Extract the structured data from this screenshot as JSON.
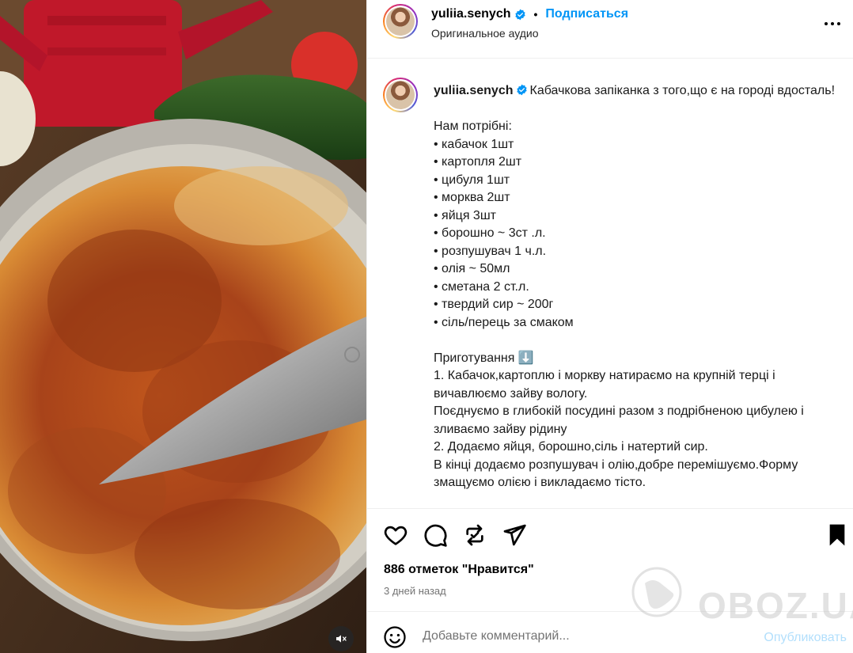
{
  "media": {
    "mute_icon": "speaker-muted-icon"
  },
  "header": {
    "username": "yuliia.senych",
    "separator": "•",
    "follow_label": "Подписаться",
    "audio": "Оригинальное аудио",
    "more_icon": "more-horizontal-icon"
  },
  "caption": {
    "username": "yuliia.senych",
    "text": "Кабачкова запіканка з того,що є на городі вдосталь!\n\nНам потрібні:\n• кабачок 1шт\n• картопля 2шт\n• цибуля 1шт\n• морква 2шт\n• яйця 3шт\n• борошно ~ 3ст .л.\n• розпушувач 1 ч.л.\n• олія ~ 50мл\n• сметана 2 ст.л.\n• твердий сир ~ 200г\n• сіль/перець за смаком\n\nПриготування ⬇️\n1. Кабачок,картоплю і моркву натираємо на крупній терці і вичавлюємо зайву вологу.\nПоєднуємо в глибокій посудині разом з подрібненою цибулею і зливаємо зайву рідину\n2. Додаємо яйця, борошно,сіль і натертий сир.\nВ кінці додаємо розпушувач і олію,добре перемішуємо.Форму змащуємо олією і викладаємо тісто."
  },
  "actions": {
    "like_icon": "heart-icon",
    "comment_icon": "comment-icon",
    "repost_icon": "repost-icon",
    "share_icon": "share-icon",
    "save_icon": "bookmark-icon"
  },
  "likes": "886 отметок \"Нравится\"",
  "date": "3 дней назад",
  "comment": {
    "emoji_icon": "emoji-icon",
    "placeholder": "Добавьте комментарий...",
    "publish_label": "Опубликовать"
  },
  "watermark": {
    "text": "OBOZ.UA"
  },
  "colors": {
    "accent": "#0095f6",
    "publish_disabled": "#b2dffc",
    "muted_text": "#737373"
  }
}
